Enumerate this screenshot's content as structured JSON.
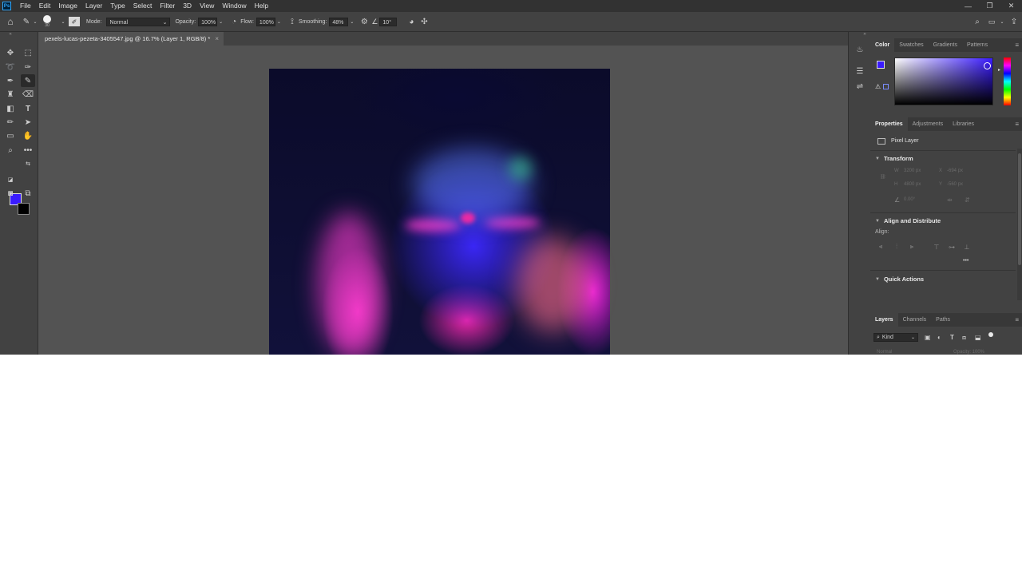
{
  "app": {
    "logo": "Ps"
  },
  "menu": [
    "File",
    "Edit",
    "Image",
    "Layer",
    "Type",
    "Select",
    "Filter",
    "3D",
    "View",
    "Window",
    "Help"
  ],
  "window_controls": {
    "minimize": "—",
    "restore": "❐",
    "close": "✕"
  },
  "options": {
    "brush_size": "30",
    "mode_label": "Mode:",
    "mode_value": "Normal",
    "opacity_label": "Opacity:",
    "opacity_value": "100%",
    "flow_label": "Flow:",
    "flow_value": "100%",
    "smoothing_label": "Smoothing:",
    "smoothing_value": "48%",
    "angle_value": "10°"
  },
  "document": {
    "tab_title": "pexels-lucas-pezeta-3405547.jpg @ 16.7% (Layer 1, RGB/8) *",
    "close": "×"
  },
  "colors": {
    "foreground": "#3a1bff",
    "background": "#000000",
    "accent": "#31a8ff"
  },
  "panels": {
    "color_tabs": [
      "Color",
      "Swatches",
      "Gradients",
      "Patterns"
    ],
    "properties_tabs": [
      "Properties",
      "Adjustments",
      "Libraries"
    ],
    "layers_tabs": [
      "Layers",
      "Channels",
      "Paths"
    ],
    "menu_glyph": "≡",
    "pixel_layer": "Pixel Layer",
    "transform": "Transform",
    "align_distribute": "Align and Distribute",
    "align_label": "Align:",
    "quick_actions": "Quick Actions",
    "w_label": "W",
    "w_value": "3200 px",
    "h_label": "H",
    "h_value": "4800 px",
    "x_label": "X",
    "x_value": "-694 px",
    "y_label": "Y",
    "y_value": "-560 px",
    "angle": "0.00°",
    "more": "•••",
    "kind_label": "Kind",
    "blend_mode": "Normal",
    "layer_opacity": "Opacity: 100%"
  }
}
